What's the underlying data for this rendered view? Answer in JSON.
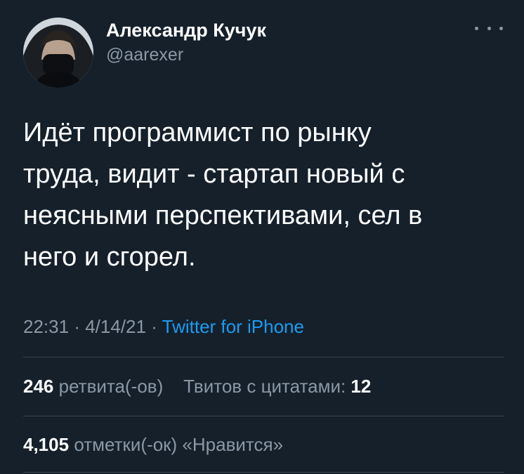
{
  "author": {
    "name": "Александр Кучук",
    "handle": "@aarexer"
  },
  "tweet": {
    "lines": [
      "Идёт программист по рынку",
      "труда, видит - стартап новый с",
      "неясными перспективами, сел в",
      "него и сгорел."
    ],
    "time": "22:31",
    "date": "4/14/21",
    "separator": "·",
    "source": "Twitter for iPhone"
  },
  "stats": {
    "retweets_count": "246",
    "retweets_label": "ретвита(-ов)",
    "quotes_label": "Твитов с цитатами:",
    "quotes_count": "12",
    "likes_count": "4,105",
    "likes_label": "отметки(-ок) «Нравится»"
  },
  "icons": {
    "more": "more-dots-icon"
  },
  "colors": {
    "background": "#15202b",
    "text": "#ffffff",
    "secondary": "#8b98a5",
    "link": "#1d9bf0",
    "divider": "#38444d"
  }
}
